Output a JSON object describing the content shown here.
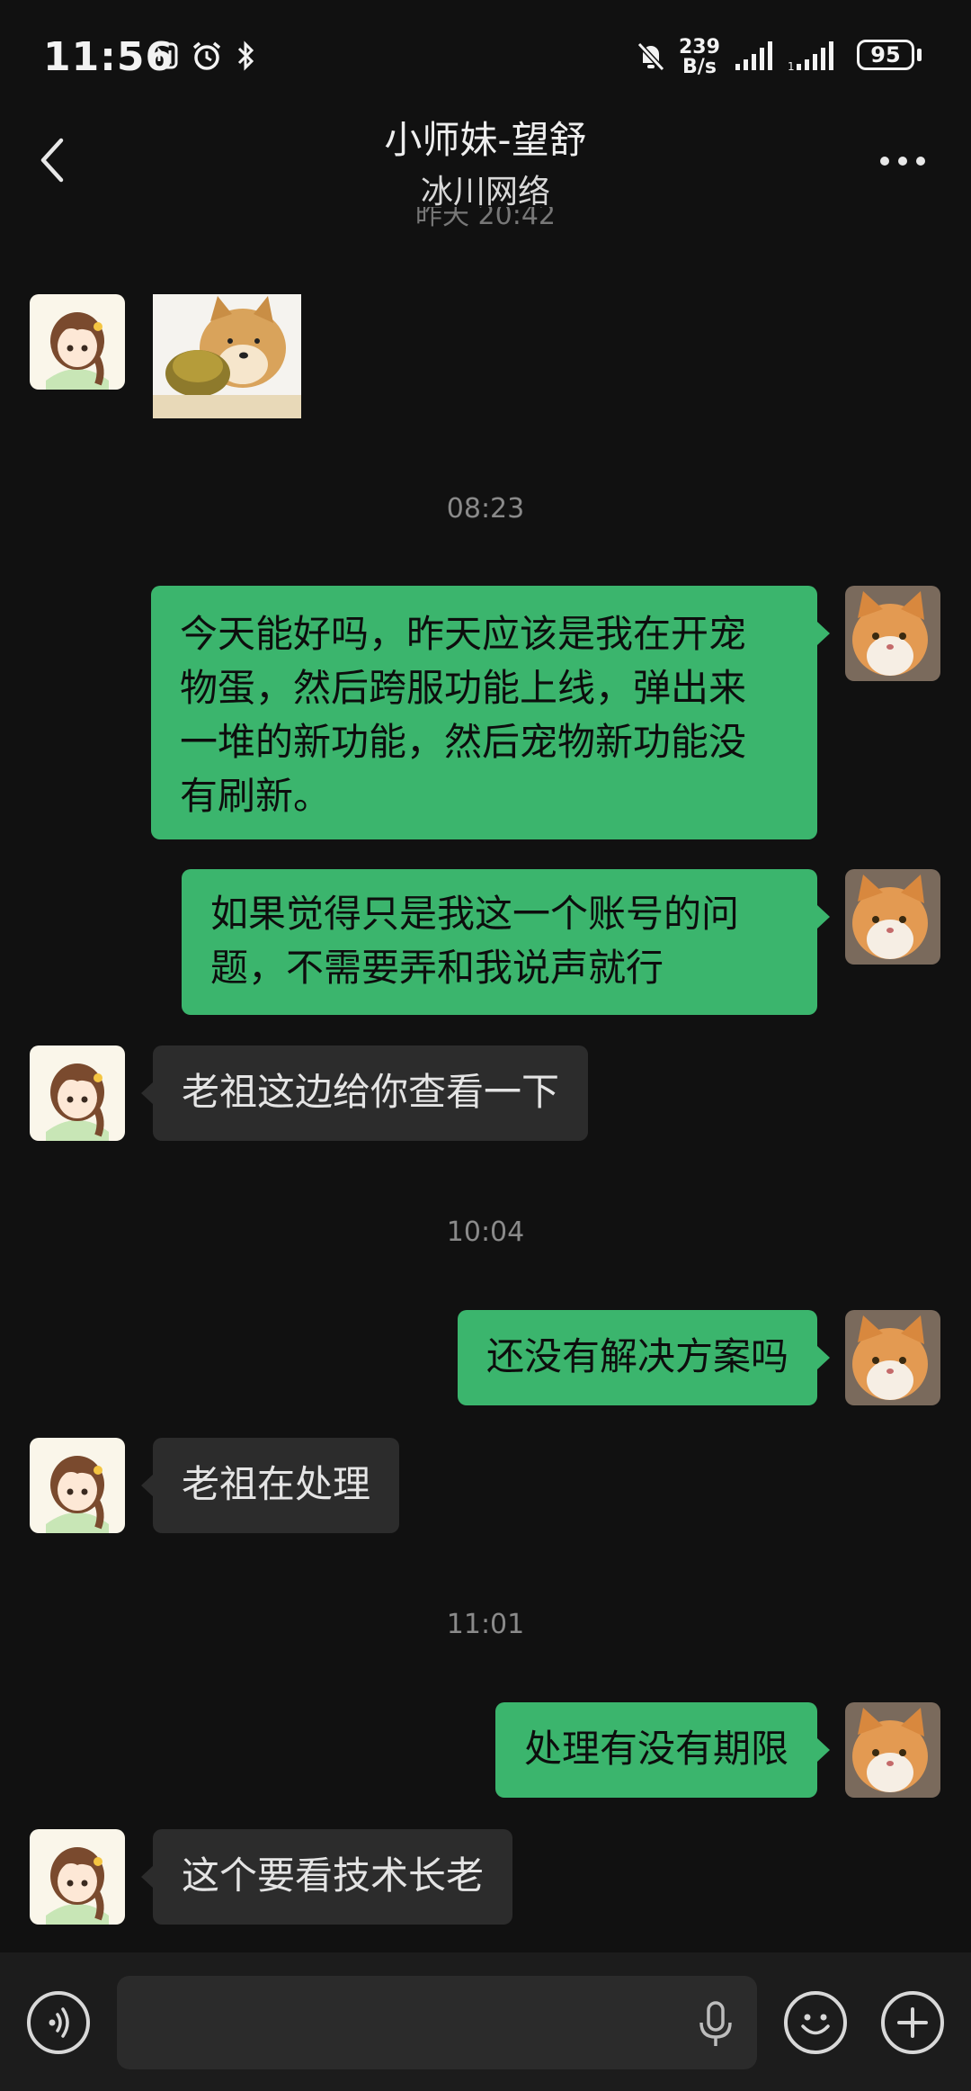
{
  "status_bar": {
    "time": "11:56",
    "net_speed_value": "239",
    "net_speed_unit": "B/s",
    "battery": "95",
    "icons": [
      "nfc-icon",
      "alarm-icon",
      "bluetooth-icon",
      "mute-icon",
      "signal-icon",
      "signal2-icon",
      "battery-icon"
    ]
  },
  "header": {
    "title": "小师妹-望舒",
    "subtitle": "冰川网络",
    "partial_timestamp": "昨天 20:42"
  },
  "messages": [
    {
      "type": "image",
      "from": "them",
      "image": "shiba-doge-sticker"
    },
    {
      "type": "timestamp",
      "text": "08:23"
    },
    {
      "type": "text",
      "from": "me",
      "lines": [
        "今天能好吗，昨天应该是我在开宠",
        "物蛋，然后跨服功能上线，弹出来",
        "一堆的新功能，然后宠物新功能没",
        "有刷新。"
      ]
    },
    {
      "type": "text",
      "from": "me",
      "lines": [
        "如果觉得只是我这一个账号的问",
        "题，不需要弄和我说声就行"
      ]
    },
    {
      "type": "text",
      "from": "them",
      "text": "老祖这边给你查看一下"
    },
    {
      "type": "timestamp",
      "text": "10:04"
    },
    {
      "type": "text",
      "from": "me",
      "text": "还没有解决方案吗"
    },
    {
      "type": "text",
      "from": "them",
      "text": "老祖在处理"
    },
    {
      "type": "timestamp",
      "text": "11:01"
    },
    {
      "type": "text",
      "from": "me",
      "text": "处理有没有期限"
    },
    {
      "type": "text",
      "from": "them",
      "text": "这个要看技术长老"
    }
  ],
  "input_bar": {
    "value": "",
    "icons": [
      "voice-icon",
      "mic-icon",
      "emoji-icon",
      "plus-icon"
    ]
  },
  "colors": {
    "background": "#111111",
    "my_bubble": "#3bb56d",
    "their_bubble": "#2c2c2c",
    "timestamp": "#8a8a8a"
  }
}
